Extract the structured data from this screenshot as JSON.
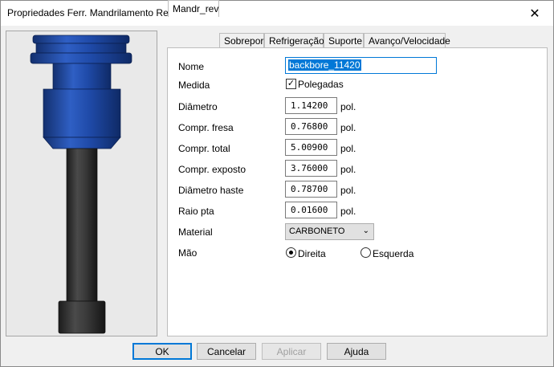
{
  "window": {
    "title": "Propriedades Ferr. Mandrilamento Reverso",
    "close_label": "✕"
  },
  "tabs": [
    {
      "label": "Mandr_rev"
    },
    {
      "label": "Sobrepor"
    },
    {
      "label": "Refrigeração"
    },
    {
      "label": "Suporte"
    },
    {
      "label": "Avanço/Velocidade"
    }
  ],
  "form": {
    "nome": {
      "label": "Nome",
      "value": "backbore_11420"
    },
    "medida": {
      "label": "Medida",
      "checkbox_label": "Polegadas",
      "checked": true
    },
    "fields": [
      {
        "label": "Diâmetro",
        "value": "1.14200",
        "unit": "pol."
      },
      {
        "label": "Compr. fresa",
        "value": "0.76800",
        "unit": "pol."
      },
      {
        "label": "Compr. total",
        "value": "5.00900",
        "unit": "pol."
      },
      {
        "label": "Compr. exposto",
        "value": "3.76000",
        "unit": "pol."
      },
      {
        "label": "Diâmetro haste",
        "value": "0.78700",
        "unit": "pol."
      },
      {
        "label": "Raio pta",
        "value": "0.01600",
        "unit": "pol."
      }
    ],
    "material": {
      "label": "Material",
      "value": "CARBONETO"
    },
    "mao": {
      "label": "Mão",
      "options": [
        "Direita",
        "Esquerda"
      ],
      "selected": "Direita"
    }
  },
  "buttons": {
    "ok": "OK",
    "cancel": "Cancelar",
    "apply": "Aplicar",
    "help": "Ajuda"
  },
  "colors": {
    "tool_body": "#1f4aa8",
    "tool_shank": "#3a3a3a",
    "selection": "#0078d7"
  }
}
